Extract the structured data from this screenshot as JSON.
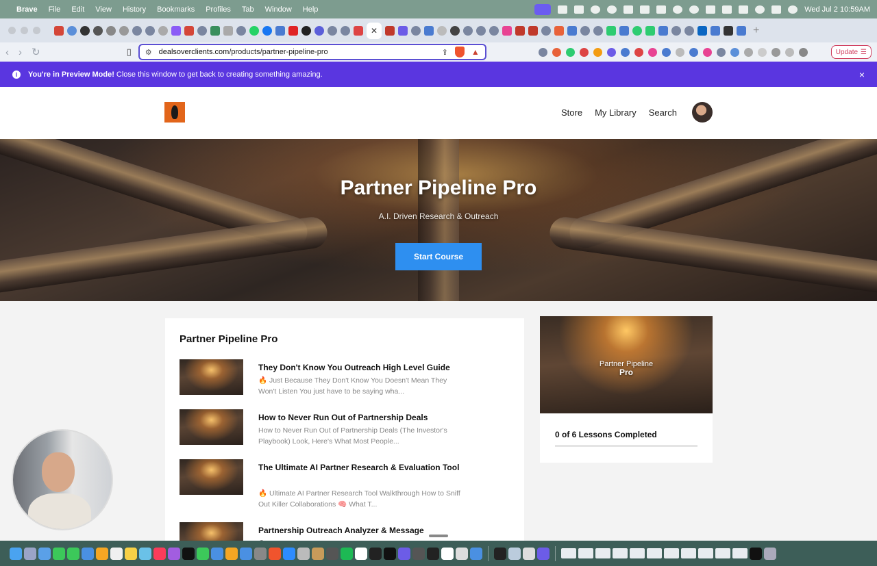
{
  "menubar": {
    "app": "Brave",
    "items": [
      "File",
      "Edit",
      "View",
      "History",
      "Bookmarks",
      "Profiles",
      "Tab",
      "Window",
      "Help"
    ],
    "clock": "Wed Jul 2  10:59AM"
  },
  "toolbar": {
    "url_domain": "dealsoverclients.com",
    "url_path": "/products/partner-pipeline-pro",
    "update_label": "Update"
  },
  "banner": {
    "bold": "You're in Preview Mode!",
    "text": "Close this window to get back to creating something amazing.",
    "close": "×"
  },
  "header": {
    "nav": [
      "Store",
      "My Library",
      "Search"
    ]
  },
  "hero": {
    "title": "Partner Pipeline Pro",
    "subtitle": "A.I. Driven Research & Outreach",
    "button": "Start Course"
  },
  "course": {
    "title": "Partner Pipeline Pro",
    "lessons": [
      {
        "title": "They Don't Know You Outreach High Level Guide",
        "desc": "🔥 Just Because They Don't Know You Doesn't Mean They Won't Listen You just have to be saying wha..."
      },
      {
        "title": "How to Never Run Out of Partnership Deals",
        "desc": "How to Never Run Out of Partnership Deals (The Investor's Playbook) Look, Here's What Most People..."
      },
      {
        "title": "The Ultimate AI Partner Research & Evaluation Tool",
        "desc": "🔥 Ultimate AI Partner Research Tool Walkthrough How to Sniff Out Killer Collaborations 🧠 What T..."
      },
      {
        "title": "Partnership Outreach Analyzer & Message Generator",
        "desc": ""
      }
    ]
  },
  "sidebar": {
    "image_text_line1": "Partner Pipeline",
    "image_text_line2": "Pro",
    "progress_label": "0 of 6 Lessons Completed",
    "progress_fraction": 0
  },
  "colors": {
    "banner": "#5a36e0",
    "accent": "#2e8ff0",
    "menubar": "#7d9c8f"
  }
}
